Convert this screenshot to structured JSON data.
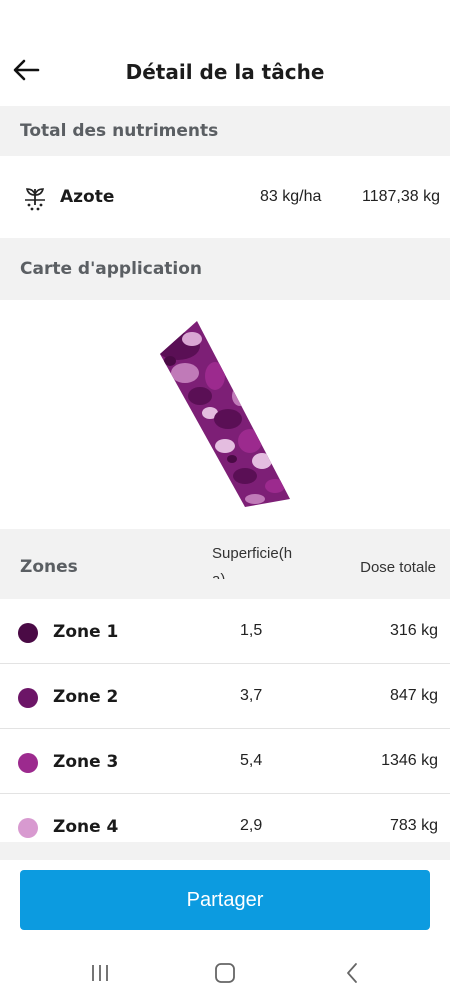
{
  "header": {
    "title": "Détail de la tâche",
    "back_icon": "arrow-left-icon"
  },
  "nutrients": {
    "section_title": "Total des nutriments",
    "items": [
      {
        "icon": "plant-nutrient-icon",
        "name": "Azote",
        "rate": "83 kg/ha",
        "total": "1187,38 kg"
      }
    ]
  },
  "map": {
    "section_title": "Carte d'application"
  },
  "zones": {
    "columns": {
      "zones": "Zones",
      "area": "Superficie(ha)",
      "dose": "Dose totale"
    },
    "rows": [
      {
        "name": "Zone 1",
        "area": "1,5",
        "dose": "316 kg",
        "color": "#4a0a45"
      },
      {
        "name": "Zone 2",
        "area": "3,7",
        "dose": "847 kg",
        "color": "#6c1567"
      },
      {
        "name": "Zone 3",
        "area": "5,4",
        "dose": "1346 kg",
        "color": "#9c2a8e"
      },
      {
        "name": "Zone 4",
        "area": "2,9",
        "dose": "783 kg",
        "color": "#d89ad0"
      }
    ]
  },
  "actions": {
    "share": "Partager"
  },
  "colors": {
    "accent": "#0c9be0",
    "section_bg": "#f2f2f2"
  },
  "system_nav": {
    "recent": "recent-apps-icon",
    "home": "home-icon",
    "back": "back-chevron-icon"
  }
}
